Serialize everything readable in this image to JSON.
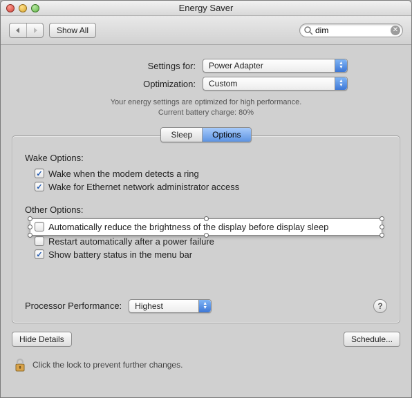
{
  "window": {
    "title": "Energy Saver"
  },
  "toolbar": {
    "show_all": "Show All"
  },
  "search": {
    "value": "dim"
  },
  "settings_for": {
    "label": "Settings for:",
    "value": "Power Adapter"
  },
  "optimization": {
    "label": "Optimization:",
    "value": "Custom"
  },
  "info_line1": "Your energy settings are optimized for high performance.",
  "info_line2": "Current battery charge: 80%",
  "tabs": {
    "sleep": "Sleep",
    "options": "Options",
    "active": "options"
  },
  "wake_section": {
    "title": "Wake Options:",
    "items": [
      {
        "checked": true,
        "label": "Wake when the modem detects a ring"
      },
      {
        "checked": true,
        "label": "Wake for Ethernet network administrator access"
      }
    ]
  },
  "other_section": {
    "title": "Other Options:",
    "items": [
      {
        "checked": false,
        "label": "Automatically reduce the brightness of the display before display sleep",
        "highlighted": true
      },
      {
        "checked": false,
        "label": "Restart automatically after a power failure"
      },
      {
        "checked": true,
        "label": "Show battery status in the menu bar"
      }
    ]
  },
  "processor": {
    "label": "Processor Performance:",
    "value": "Highest"
  },
  "buttons": {
    "hide_details": "Hide Details",
    "schedule": "Schedule..."
  },
  "lock_text": "Click the lock to prevent further changes."
}
